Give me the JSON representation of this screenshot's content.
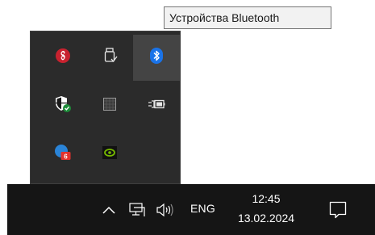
{
  "tooltip": {
    "text": "Устройства Bluetooth"
  },
  "tray_flyout": {
    "icons": [
      {
        "name": "antivirus-shield-icon",
        "hovered": false
      },
      {
        "name": "usb-safely-remove-icon",
        "hovered": false
      },
      {
        "name": "bluetooth-icon",
        "hovered": true
      },
      {
        "name": "windows-security-icon",
        "hovered": false
      },
      {
        "name": "grid-app-icon",
        "hovered": false
      },
      {
        "name": "power-battery-icon",
        "hovered": false
      },
      {
        "name": "app-badge-icon",
        "hovered": false,
        "badge": "6"
      },
      {
        "name": "nvidia-icon",
        "hovered": false
      }
    ]
  },
  "taskbar": {
    "language": "ENG",
    "time": "12:45",
    "date": "13.02.2024",
    "icons": [
      "show-hidden-icons-chevron-icon",
      "network-icon",
      "volume-icon",
      "notifications-icon"
    ]
  }
}
